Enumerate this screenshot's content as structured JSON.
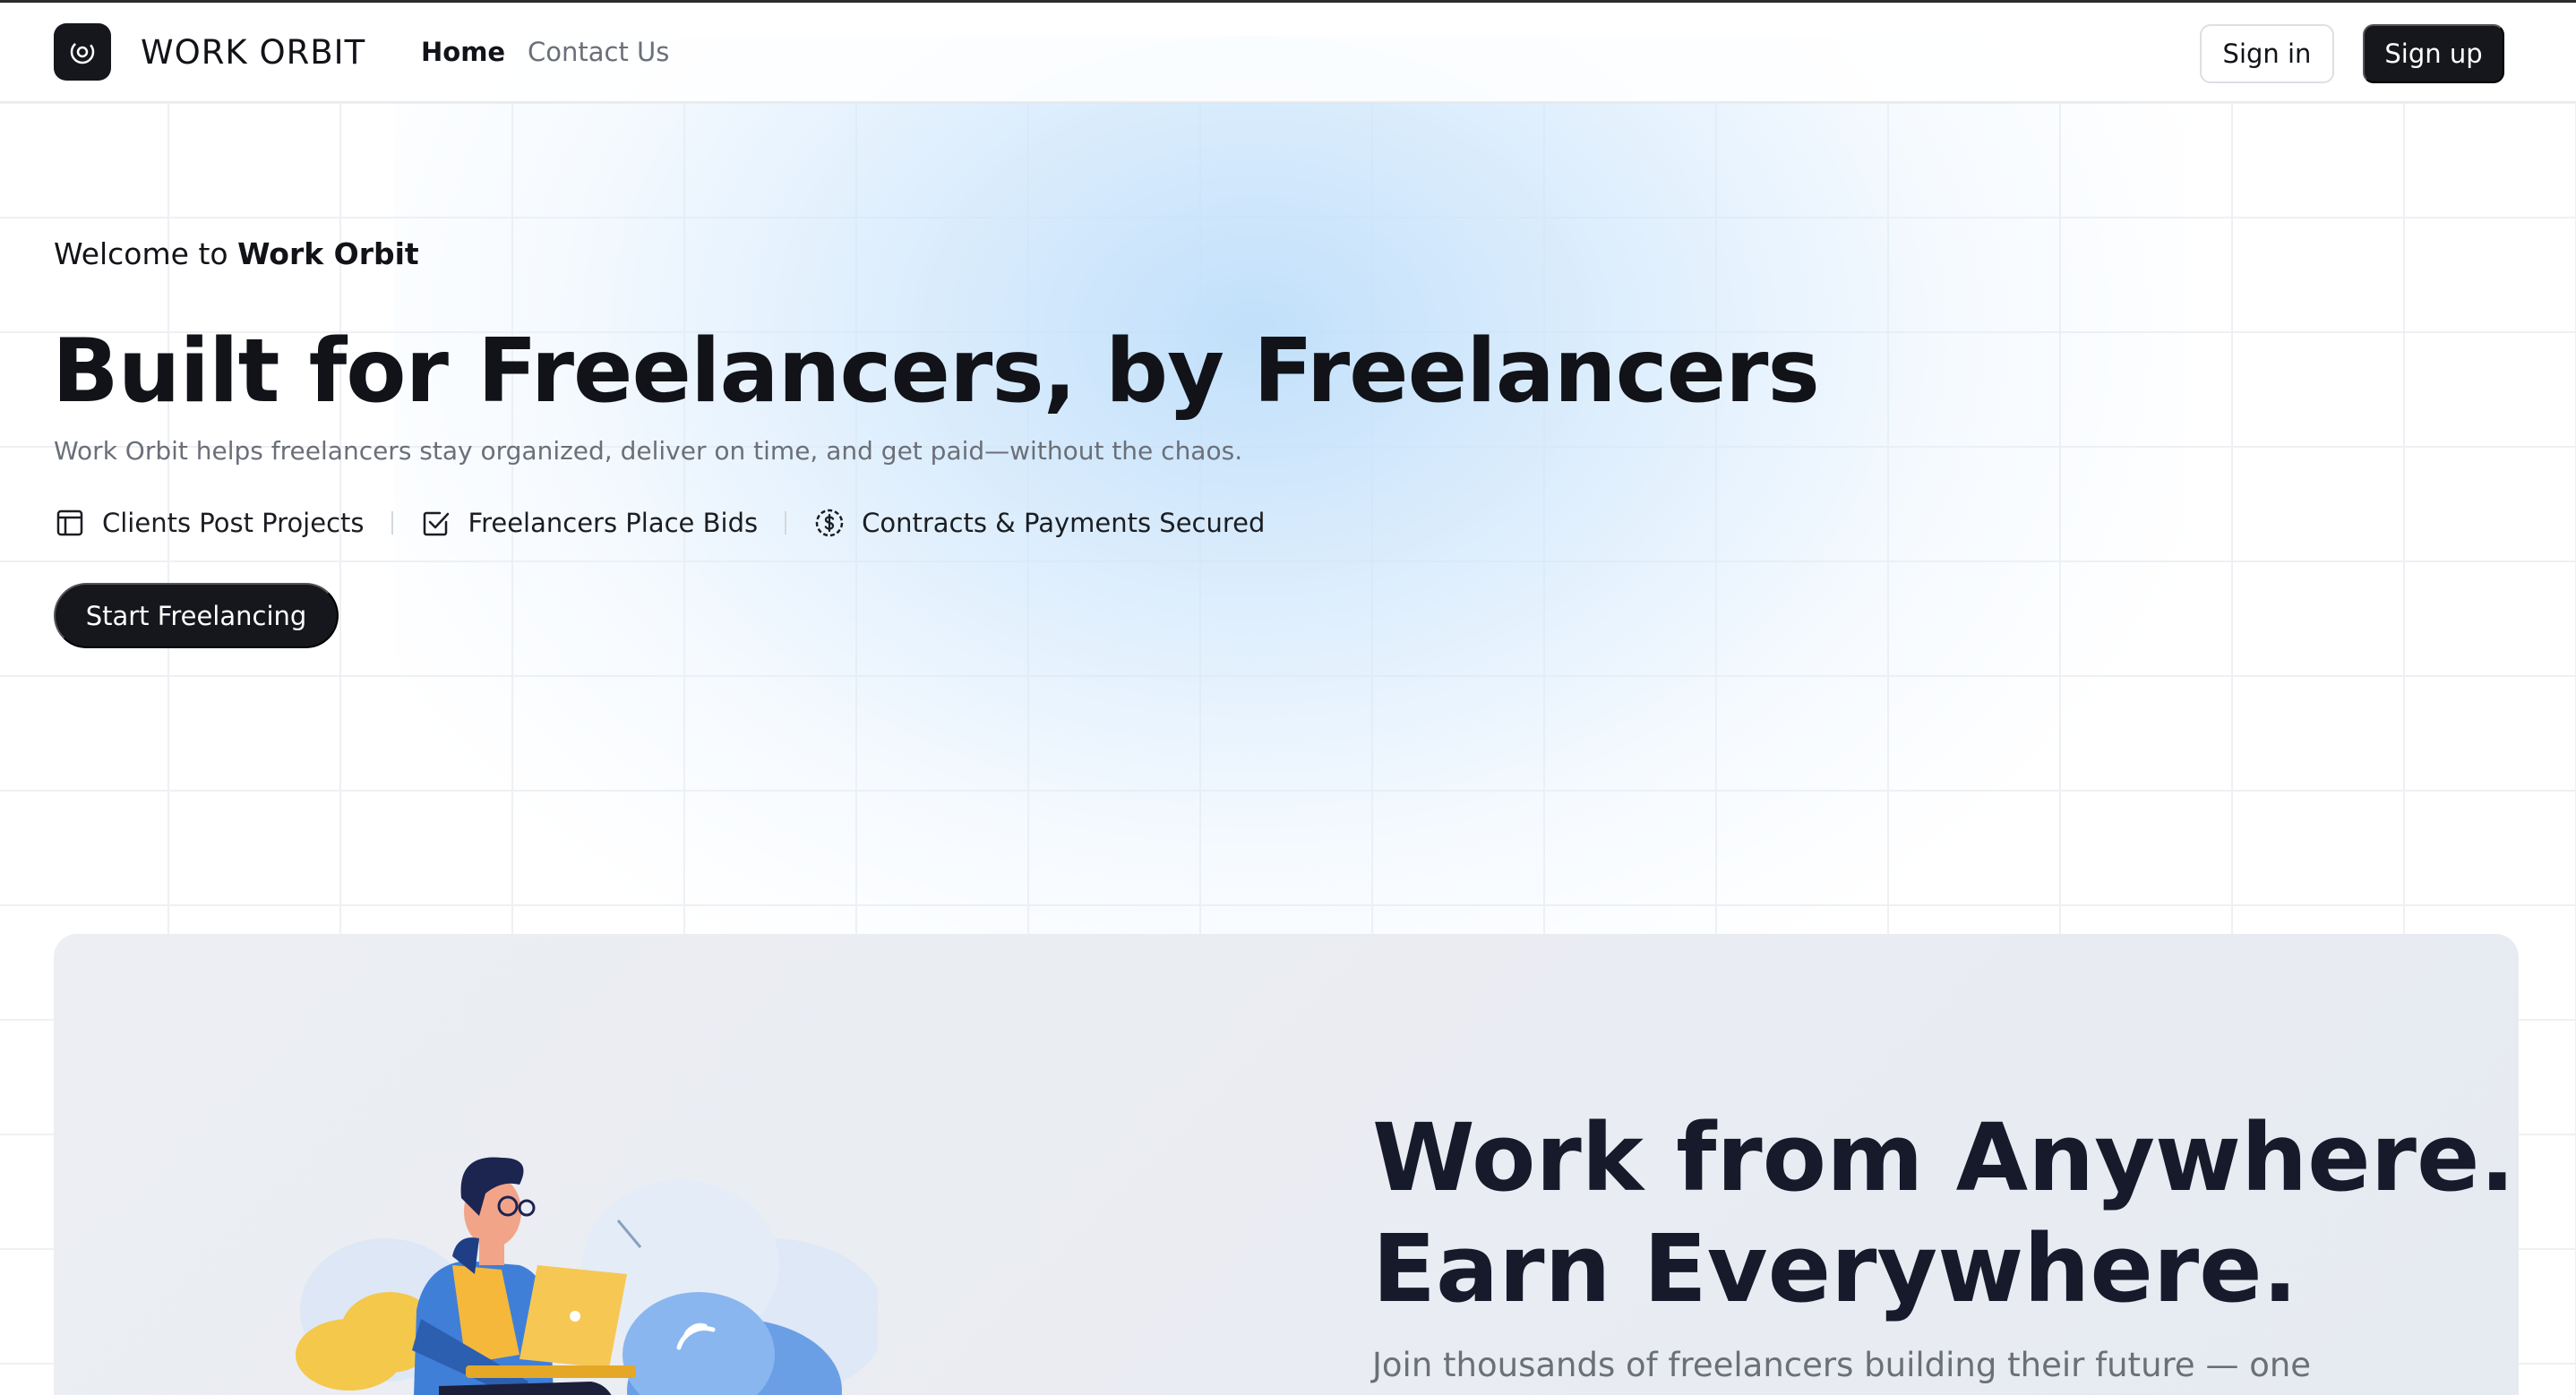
{
  "header": {
    "brand": "WORK ORBIT",
    "logo_icon": "orbit-icon",
    "nav": [
      {
        "label": "Home",
        "active": true
      },
      {
        "label": "Contact Us",
        "active": false
      }
    ],
    "signin_label": "Sign in",
    "signup_label": "Sign up"
  },
  "hero": {
    "welcome_prefix": "Welcome to ",
    "welcome_brand": "Work Orbit",
    "title": "Built for Freelancers, by Freelancers",
    "subtitle": "Work Orbit helps freelancers stay organized, deliver on time, and get paid—without the chaos.",
    "features": [
      {
        "label": "Clients Post Projects",
        "icon": "layout-icon"
      },
      {
        "label": "Freelancers Place Bids",
        "icon": "checkbox-icon"
      },
      {
        "label": "Contracts & Payments Secured",
        "icon": "dollar-circle-icon"
      }
    ],
    "cta_label": "Start Freelancing"
  },
  "card": {
    "title_line1": "Work from Anywhere.",
    "title_line2": "Earn Everywhere.",
    "subtitle": "Join thousands of freelancers building their future — one",
    "illustration": "freelancer-with-laptop-illustration"
  },
  "colors": {
    "primary": "#15171c",
    "muted_text": "#6b6f78",
    "glow": "#cfe6fb",
    "card_bg": "#eceef3"
  }
}
